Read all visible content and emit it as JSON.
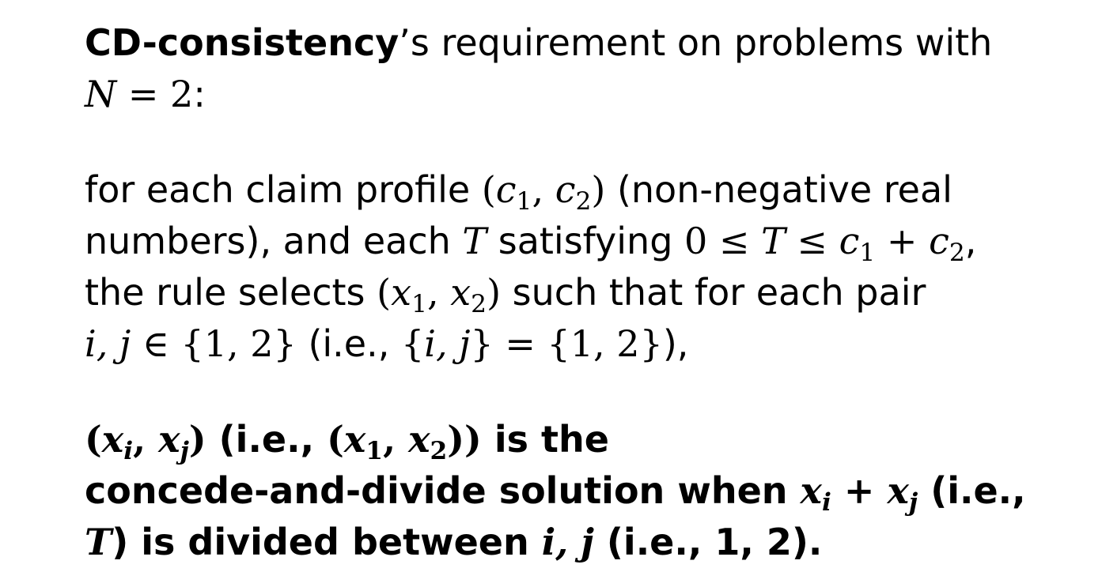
{
  "slide": {
    "definition_term": "CD-consistency",
    "definition_intro_suffix": "’s requirement on problems with",
    "n_condition_var": "N",
    "n_condition_eq": " = 2",
    "n_condition_colon": ":",
    "p2_text1": "for each claim profile ",
    "p2_profile_open": "(",
    "p2_c": "c",
    "p2_sub1": "1",
    "p2_comma1": ", ",
    "p2_sub2": "2",
    "p2_profile_close": ")",
    "p2_text2": " (non-negative real numbers), and each ",
    "p2_T1": "T",
    "p2_text3": " satisfying ",
    "p2_zero_le": "0 ≤ ",
    "p2_T2": "T",
    "p2_le": " ≤ ",
    "p2_c_sum1": "c",
    "p2_sum_sub1": "1",
    "p2_plus": " + ",
    "p2_c_sum2": "c",
    "p2_sum_sub2": "2",
    "p2_text4": ",",
    "p3_text1": "the rule selects ",
    "p3_open": "(",
    "p3_x": "x",
    "p3_sub1": "1",
    "p3_comma": ", ",
    "p3_sub2": "2",
    "p3_close": ")",
    "p3_text2": " such that for each pair",
    "p4_ij": "i, j",
    "p4_in": " ∈ {1, 2}",
    "p4_text1": " (i.e., ",
    "p4_set_open": "{",
    "p4_set_ij": "i, j",
    "p4_set_eq": "} = {1, 2}",
    "p4_text2": "),",
    "b1_open": "(",
    "b1_xi": "x",
    "b1_i": "i",
    "b1_comma": ", ",
    "b1_xj": "x",
    "b1_j": "j",
    "b1_close": ")",
    "b1_text1": " (i.e., ",
    "b1_open2": "(",
    "b1_x1": "x",
    "b1_1": "1",
    "b1_comma2": ", ",
    "b1_x2": "x",
    "b1_2": "2",
    "b1_close2": "))",
    "b1_text2": " is the",
    "b2_text1": "concede-and-divide solution when ",
    "b2_xi": "x",
    "b2_i": "i",
    "b2_plus": " + ",
    "b2_xj": "x",
    "b2_j": "j",
    "b2_text2": " (i.e.,",
    "b3_T": "T",
    "b3_text1": ") is divided between ",
    "b3_ij": "i, j",
    "b3_text2": " (i.e., 1, 2)."
  }
}
